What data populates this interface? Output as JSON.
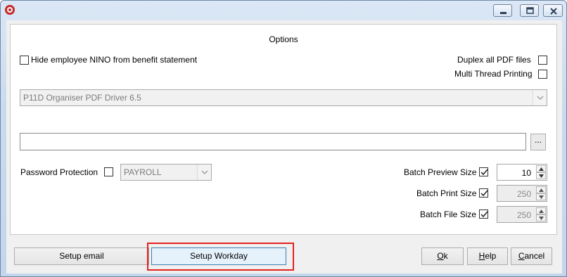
{
  "window": {
    "title_icon": "app-logo-icon",
    "controls": [
      "minimize-icon",
      "maximize-icon",
      "close-icon"
    ]
  },
  "options": {
    "title": "Options",
    "hide_nino_label": "Hide employee NINO from benefit statement",
    "hide_nino_checked": false,
    "duplex_label": "Duplex all PDF files",
    "duplex_checked": false,
    "multithread_label": "Multi Thread  Printing",
    "multithread_checked": false,
    "pdf_driver_value": "P11D Organiser PDF Driver 6.5",
    "path_value": "",
    "browse_label": "...",
    "password_label": "Password Protection",
    "password_checked": false,
    "password_value": "PAYROLL",
    "batch_preview_label": "Batch Preview Size",
    "batch_preview_checked": true,
    "batch_preview_value": "10",
    "batch_print_label": "Batch Print Size",
    "batch_print_checked": true,
    "batch_print_value": "250",
    "batch_file_label": "Batch File Size",
    "batch_file_checked": true,
    "batch_file_value": "250"
  },
  "buttons": {
    "setup_email": "Setup email",
    "setup_workday": "Setup Workday",
    "ok": "Ok",
    "help": "Help",
    "cancel": "Cancel"
  },
  "colors": {
    "highlight_box": "#e0231f",
    "focused_button": "#e5f1fb"
  }
}
